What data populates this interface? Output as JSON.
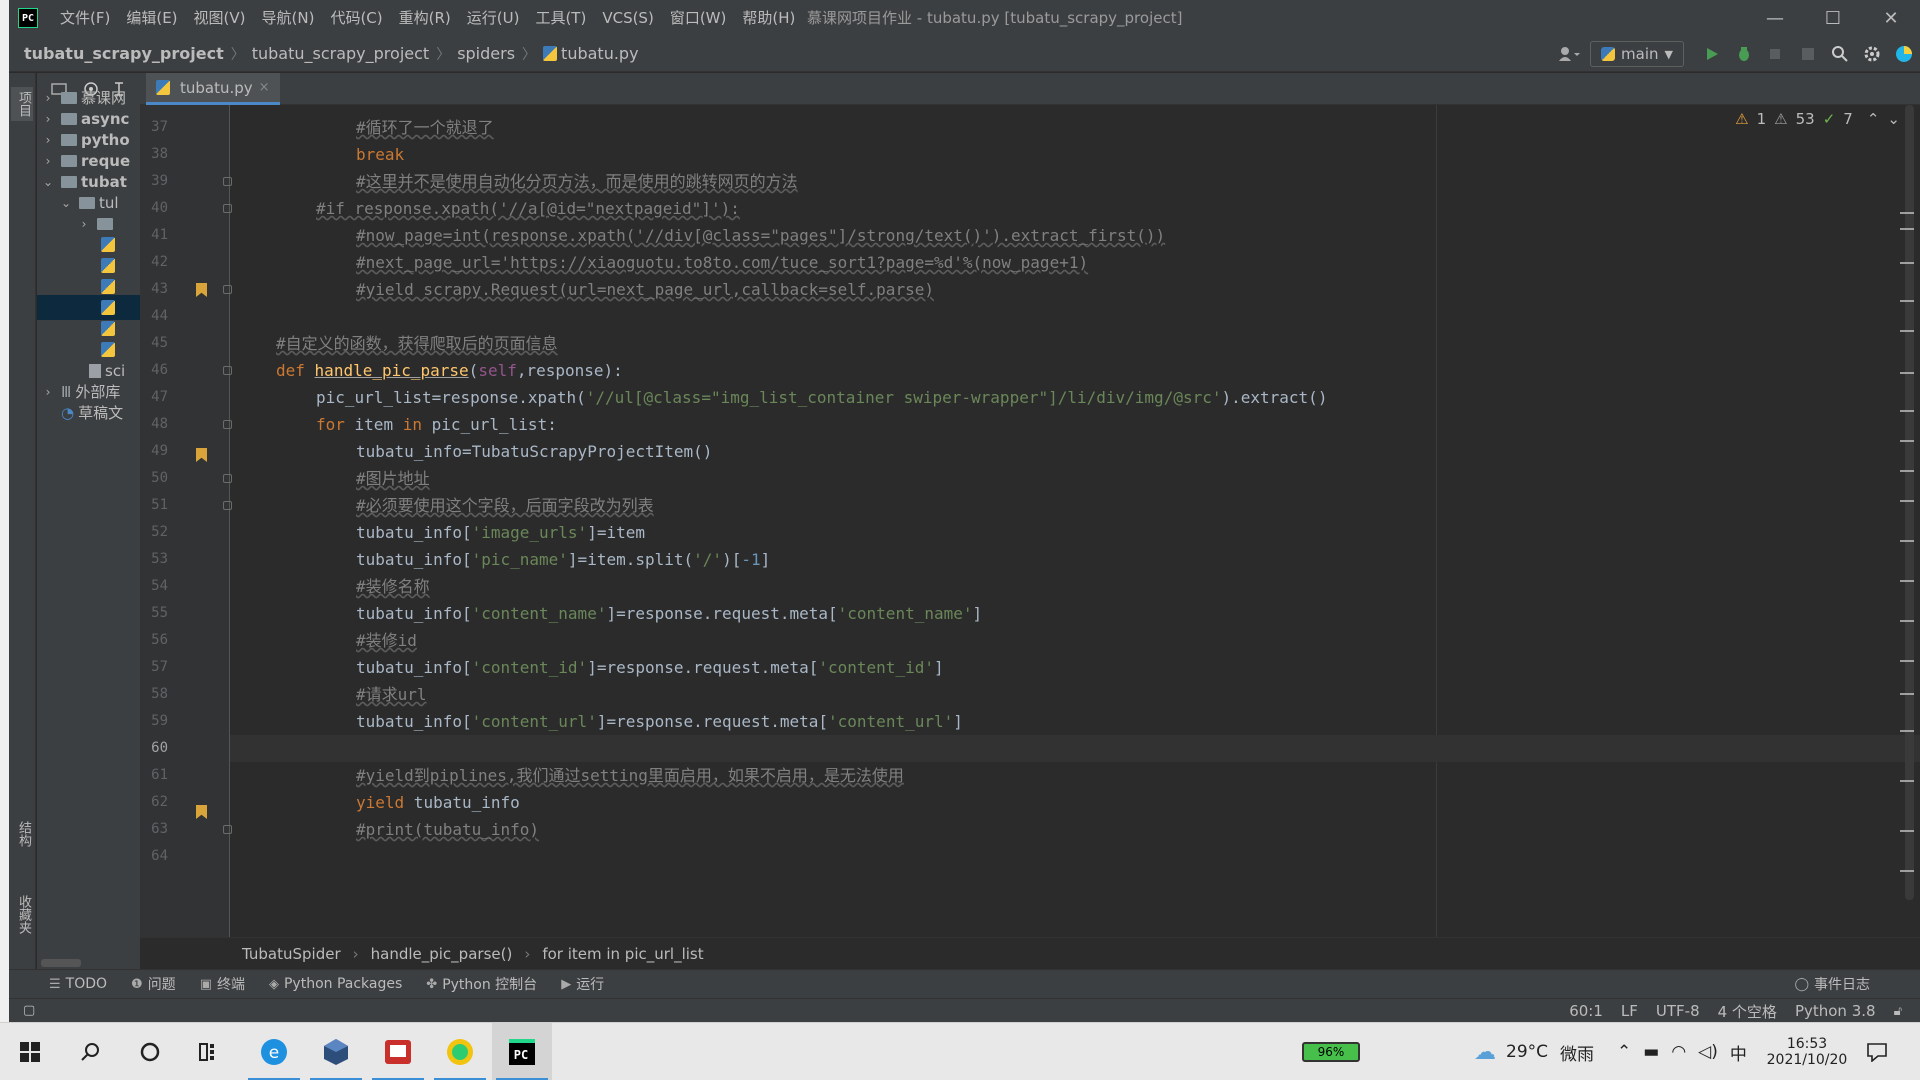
{
  "window": {
    "title": "慕课网项目作业 - tubatu.py [tubatu_scrapy_project]",
    "logo_text": "PC",
    "minimize": "—",
    "maximize": "☐",
    "close": "✕"
  },
  "menu": [
    "文件(F)",
    "编辑(E)",
    "视图(V)",
    "导航(N)",
    "代码(C)",
    "重构(R)",
    "运行(U)",
    "工具(T)",
    "VCS(S)",
    "窗口(W)",
    "帮助(H)"
  ],
  "breadcrumbs": [
    "tubatu_scrapy_project",
    "tubatu_scrapy_project",
    "spiders",
    "tubatu.py"
  ],
  "run_config": {
    "label": "main"
  },
  "left_strip": {
    "project": "项目",
    "structure": "结构",
    "favorites": "收藏夹"
  },
  "project_tree": [
    {
      "label": "慕课网",
      "expanded": false
    },
    {
      "label": "async",
      "expanded": false
    },
    {
      "label": "pytho",
      "expanded": false
    },
    {
      "label": "reque",
      "expanded": false
    },
    {
      "label": "tubat",
      "expanded": true
    },
    {
      "label": "tul",
      "expanded": true
    },
    {
      "label": "",
      "expanded": false
    },
    {
      "label": "外部库",
      "expanded": false
    },
    {
      "label": "草稿文",
      "expanded": false
    },
    {
      "label": "sci",
      "expanded": false
    }
  ],
  "editor_tab": {
    "label": "tubatu.py",
    "close": "×"
  },
  "inspections": {
    "errors": "1",
    "warnings": "53",
    "typos": "7"
  },
  "code": {
    "l37": "#循环了一个就退了",
    "l38": "break",
    "l39": "#这里并不是使用自动化分页方法，而是使用的跳转网页的方法",
    "l40": "#if response.xpath('//a[@id=\"nextpageid\"]'):",
    "l41": "#now_page=int(response.xpath('//div[@class=\"pages\"]/strong/text()').extract_first())",
    "l42": "#next_page_url='https://xiaoguotu.to8to.com/tuce_sort1?page=%d'%(now_page+1)",
    "l43": "#yield scrapy.Request(url=next_page_url,callback=self.parse)",
    "l45": "#自定义的函数，获得爬取后的页面信息",
    "l46_kw": "def",
    "l46_fn": "handle_pic_parse",
    "l46_self": "self",
    "l46_rest": "response):",
    "l47_a": "pic_url_list=response.xpath(",
    "l47_s": "'//ul[@class=\"img_list_container swiper-wrapper\"]/li/div/img/@src'",
    "l47_b": ").extract()",
    "l48_for": "for",
    "l48_mid": " item ",
    "l48_in": "in",
    "l48_end": " pic_url_list:",
    "l49": "tubatu_info=TubatuScrapyProjectItem()",
    "l50": "#图片地址",
    "l51": "#必须要使用这个字段，后面字段改为列表",
    "l52_a": "tubatu_info[",
    "l52_s": "'image_urls'",
    "l52_b": "]=item",
    "l53_a": "tubatu_info[",
    "l53_s": "'pic_name'",
    "l53_b": "]=item.split(",
    "l53_s2": "'/'",
    "l53_c": ")[",
    "l53_n": "-1",
    "l53_d": "]",
    "l54": "#装修名称",
    "l55_a": "tubatu_info[",
    "l55_s": "'content_name'",
    "l55_b": "]=response.request.meta[",
    "l55_s2": "'content_name'",
    "l55_c": "]",
    "l56": "#装修id",
    "l57_a": "tubatu_info[",
    "l57_s": "'content_id'",
    "l57_b": "]=response.request.meta[",
    "l57_s2": "'content_id'",
    "l57_c": "]",
    "l58": "#请求url",
    "l59_a": "tubatu_info[",
    "l59_s": "'content_url'",
    "l59_b": "]=response.request.meta[",
    "l59_s2": "'content_url'",
    "l59_c": "]",
    "l61": "#yield到piplines,我们通过setting里面启用，如果不启用，是无法使用",
    "l62_kw": "yield",
    "l62_rest": " tubatu_info",
    "l63": "#print(tubatu_info)"
  },
  "line_numbers": [
    "37",
    "38",
    "39",
    "40",
    "41",
    "42",
    "43",
    "44",
    "45",
    "46",
    "47",
    "48",
    "49",
    "50",
    "51",
    "52",
    "53",
    "54",
    "55",
    "56",
    "57",
    "58",
    "59",
    "60",
    "61",
    "62",
    "63",
    "64"
  ],
  "editor_breadcrumbs": [
    "TubatuSpider",
    "handle_pic_parse()",
    "for item in pic_url_list"
  ],
  "tool_windows": [
    "TODO",
    "问题",
    "终端",
    "Python Packages",
    "Python 控制台",
    "运行"
  ],
  "event_log": "事件日志",
  "status": {
    "position": "60:1",
    "line_sep": "LF",
    "encoding": "UTF-8",
    "indent": "4 个空格",
    "interpreter": "Python 3.8"
  },
  "taskbar": {
    "battery": "96%",
    "temperature": "29°C",
    "weather": "微雨",
    "ime": "中",
    "time": "16:53",
    "date": "2021/10/20"
  },
  "colors": {
    "accent": "#4a88c7",
    "keyword": "#cc7832",
    "string": "#6a8759",
    "comment": "#808080",
    "function": "#ffc66d"
  }
}
